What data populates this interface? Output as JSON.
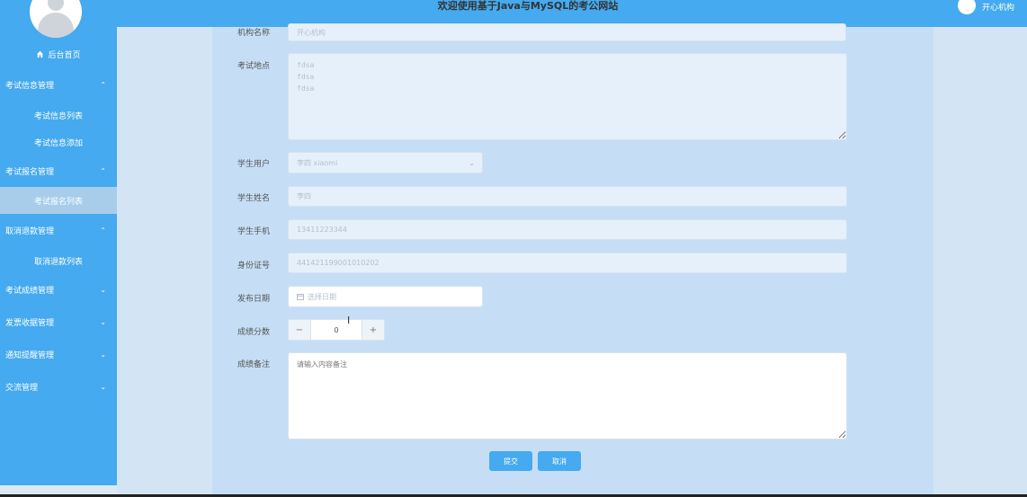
{
  "header": {
    "title": "欢迎使用基于Java与MySQL的考公网站",
    "user_name": "开心机构"
  },
  "sidebar": {
    "home": "后台首页",
    "menus": [
      {
        "label": "考试信息管理",
        "chevron": "⌃"
      },
      {
        "label": "考试报名管理",
        "chevron": "⌃"
      },
      {
        "label": "取消退款管理",
        "chevron": "⌃"
      },
      {
        "label": "考试成绩管理",
        "chevron": "⌄"
      },
      {
        "label": "发票收据管理",
        "chevron": "⌄"
      },
      {
        "label": "通知提醒管理",
        "chevron": "⌄"
      },
      {
        "label": "交流管理",
        "chevron": "⌄"
      }
    ],
    "subs": [
      {
        "label": "考试信息列表"
      },
      {
        "label": "考试信息添加"
      },
      {
        "label": "考试报名列表"
      },
      {
        "label": "取消退款列表"
      }
    ]
  },
  "form": {
    "org_label": "机构名称",
    "org_value": "开心机构",
    "place_label": "考试地点",
    "place_value": "fdsa\nfdsa\nfdsa",
    "student_user_label": "学生用户",
    "student_user_value": "李四 xiaomi",
    "student_name_label": "学生姓名",
    "student_name_value": "李四",
    "phone_label": "学生手机",
    "phone_value": "13411223344",
    "id_label": "身份证号",
    "id_value": "441421199001010202",
    "date_label": "发布日期",
    "date_placeholder": "选择日期",
    "score_label": "成绩分数",
    "score_value": "0",
    "remark_label": "成绩备注",
    "remark_placeholder": "请输入内容备注",
    "submit": "提交",
    "cancel": "取消"
  }
}
